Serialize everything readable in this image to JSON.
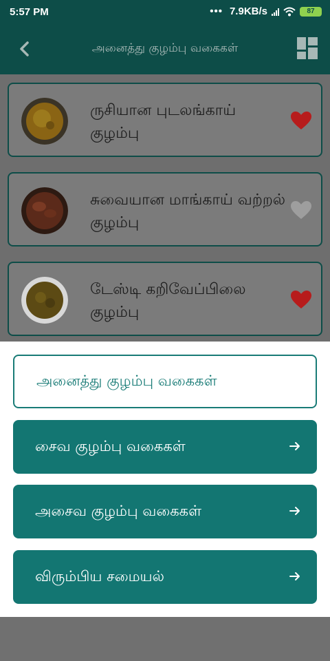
{
  "status_bar": {
    "time": "5:57 PM",
    "net_speed": "7.9KB/s",
    "battery": "87",
    "battery_color": "#8fd14f"
  },
  "app_bar": {
    "title": "அனைத்து குழம்பு வகைகள்",
    "back_icon": "chevron-left-icon",
    "layout_icon": "grid-layout-icon",
    "background": "#0d4d48"
  },
  "recipes": [
    {
      "name": "ருசியான புடலங்காய் குழம்பு",
      "favorite": true
    },
    {
      "name": "சுவையான மாங்காய் வற்றல் குழம்பு",
      "favorite": false
    },
    {
      "name": "டேஸ்டி கறிவேப்பிலை குழம்பு",
      "favorite": true
    }
  ],
  "bottom_sheet": {
    "options": [
      {
        "label": "அனைத்து குழம்பு வகைகள்",
        "selected": true
      },
      {
        "label": "சைவ குழம்பு வகைகள்",
        "selected": false
      },
      {
        "label": "அசைவ குழம்பு வகைகள்",
        "selected": false
      },
      {
        "label": "விரும்பிய சமையல்",
        "selected": false
      }
    ],
    "accent": "#137672"
  },
  "colors": {
    "favorite": "#b71c1c",
    "not_favorite": "#9e9e9e"
  }
}
